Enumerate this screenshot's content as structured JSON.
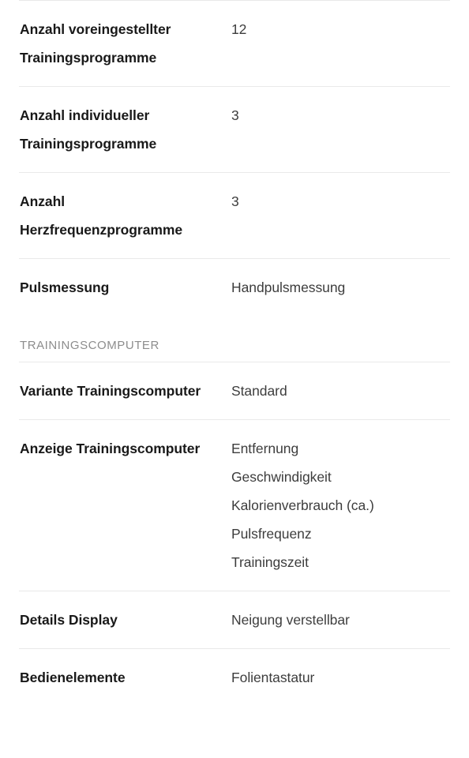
{
  "page": {
    "background_color": "#ffffff",
    "label_color": "#191919",
    "value_color": "#3d3d3d",
    "section_header_color": "#8d8d8d",
    "divider_color": "#e9e9e9"
  },
  "sections": [
    {
      "id": "specs-top",
      "header": null,
      "rows": [
        {
          "label": "Anzahl voreingestellter Trainingsprogramme",
          "values": [
            "12"
          ]
        },
        {
          "label": "Anzahl individueller Trainingsprogramme",
          "values": [
            "3"
          ]
        },
        {
          "label": "Anzahl Herzfrequenzprogramme",
          "values": [
            "3"
          ]
        },
        {
          "label": "Pulsmessung",
          "values": [
            "Handpulsmessung"
          ]
        }
      ]
    },
    {
      "id": "trainingscomputer",
      "header": "TRAININGSCOMPUTER",
      "rows": [
        {
          "label": "Variante Trainingscomputer",
          "values": [
            "Standard"
          ]
        },
        {
          "label": "Anzeige Trainingscomputer",
          "values": [
            "Entfernung",
            "Geschwindigkeit",
            "Kalorienverbrauch (ca.)",
            "Pulsfrequenz",
            "Trainingszeit"
          ]
        },
        {
          "label": "Details Display",
          "values": [
            "Neigung verstellbar"
          ]
        },
        {
          "label": "Bedienelemente",
          "values": [
            "Folientastatur"
          ]
        }
      ]
    }
  ]
}
